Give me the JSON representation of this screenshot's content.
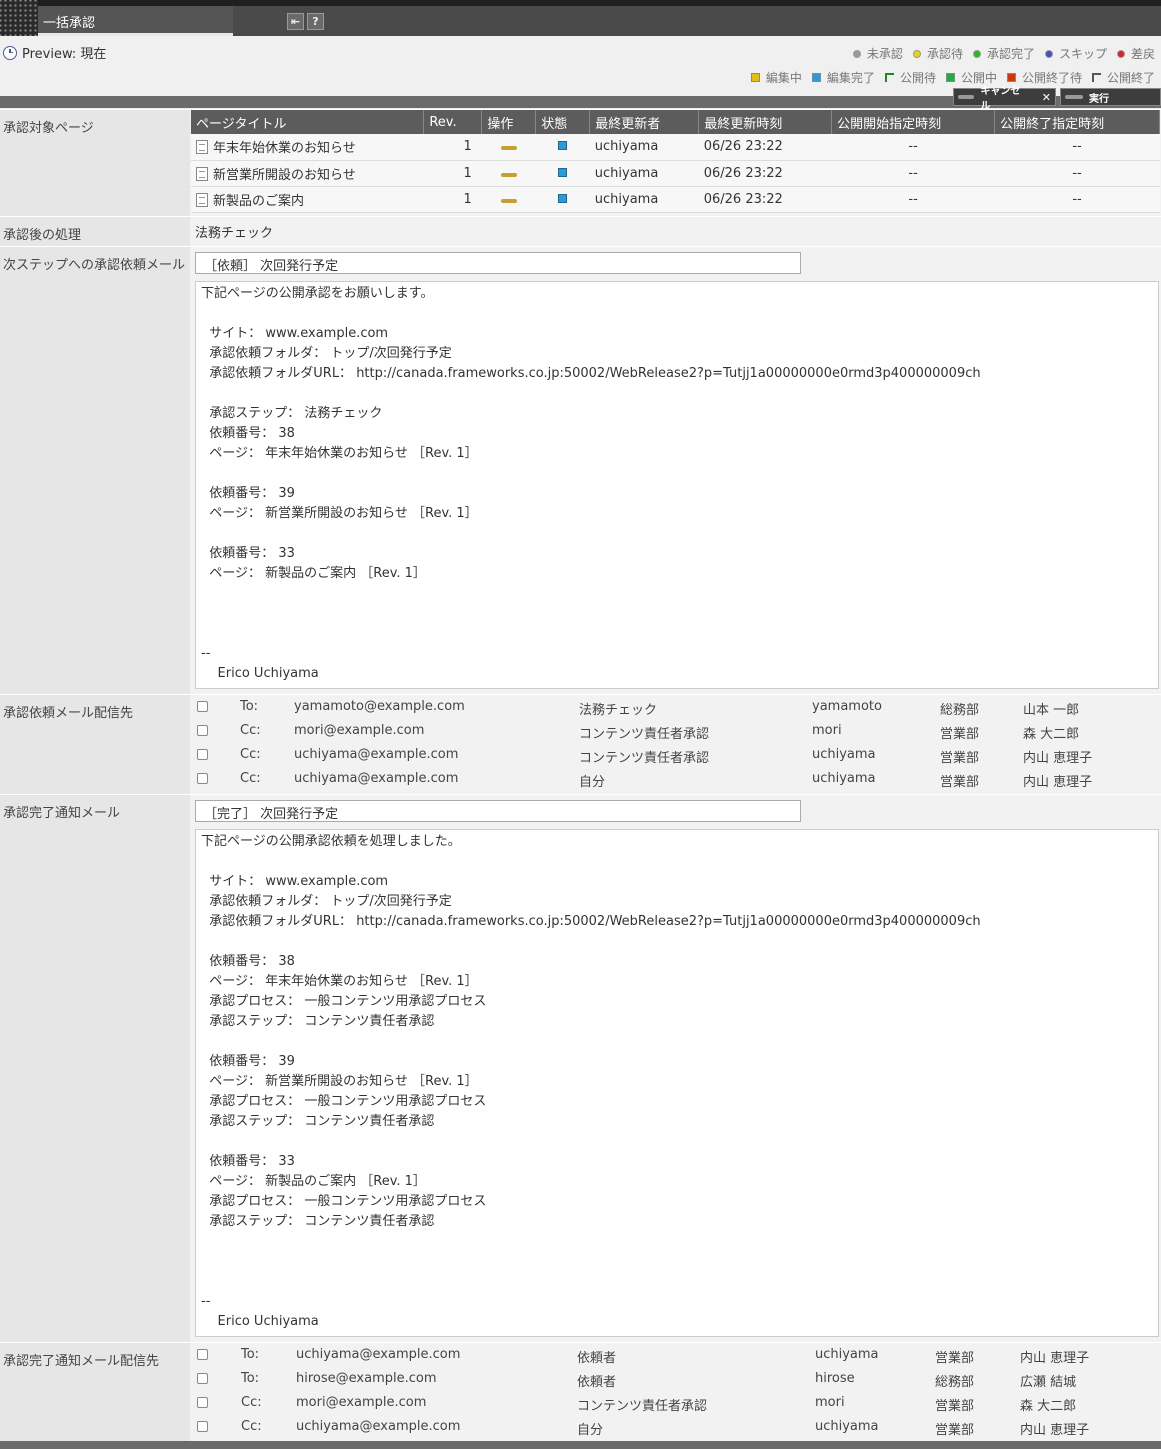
{
  "window": {
    "title": "一括承認",
    "back_label": "⇤",
    "help_label": "?"
  },
  "preview": {
    "label": "Preview: 現在"
  },
  "legend_approval": [
    {
      "label": "未承認",
      "color": "#999999"
    },
    {
      "label": "承認待",
      "color": "#e8d800"
    },
    {
      "label": "承認完了",
      "color": "#22bb22"
    },
    {
      "label": "スキップ",
      "color": "#4a4acc"
    },
    {
      "label": "差戻",
      "color": "#dd2222"
    }
  ],
  "legend_status": [
    {
      "label": "編集中",
      "color": "#e8c000",
      "shape": "square"
    },
    {
      "label": "編集完了",
      "color": "#2a9ad8",
      "shape": "square"
    },
    {
      "label": "公開待",
      "color": "#228822",
      "shape": "corner"
    },
    {
      "label": "公開中",
      "color": "#22aa44",
      "shape": "square"
    },
    {
      "label": "公開終了待",
      "color": "#dd3300",
      "shape": "square"
    },
    {
      "label": "公開終了",
      "color": "#555555",
      "shape": "corner"
    }
  ],
  "actions": {
    "cancel": "キャンセル",
    "cancel_x": "✕",
    "execute": "実行"
  },
  "rows": {
    "target_pages": "承認対象ページ",
    "after_approval": "承認後の処理",
    "next_step_mail": "次ステップへの承認依頼メール",
    "request_recipients": "承認依頼メール配信先",
    "completion_mail": "承認完了通知メール",
    "completion_recipients": "承認完了通知メール配信先"
  },
  "pages_table": {
    "headers": [
      "ページタイトル",
      "Rev.",
      "操作",
      "状態",
      "最終更新者",
      "最終更新時刻",
      "公開開始指定時刻",
      "公開終了指定時刻"
    ],
    "rows": [
      {
        "title": "年末年始休業のお知らせ",
        "rev": "1",
        "user": "uchiyama",
        "time": "06/26 23:22",
        "start": "--",
        "end": "--"
      },
      {
        "title": "新営業所開設のお知らせ",
        "rev": "1",
        "user": "uchiyama",
        "time": "06/26 23:22",
        "start": "--",
        "end": "--"
      },
      {
        "title": "新製品のご案内",
        "rev": "1",
        "user": "uchiyama",
        "time": "06/26 23:22",
        "start": "--",
        "end": "--"
      }
    ]
  },
  "after_approval_value": "法務チェック",
  "next_mail": {
    "subject": "［依頼］ 次回発行予定",
    "body": "下記ページの公開承認をお願いします。\n\n  サイト： www.example.com\n  承認依頼フォルダ： トップ/次回発行予定\n  承認依頼フォルダURL： http://canada.frameworks.co.jp:50002/WebRelease2?p=Tutjj1a00000000e0rmd3p400000009ch\n\n  承認ステップ： 法務チェック\n  依頼番号： 38\n  ページ： 年末年始休業のお知らせ ［Rev. 1］\n\n  依頼番号： 39\n  ページ： 新営業所開設のお知らせ ［Rev. 1］\n\n  依頼番号： 33\n  ページ： 新製品のご案内 ［Rev. 1］\n\n\n\n--\n    Erico Uchiyama"
  },
  "request_recipients": [
    {
      "type": "To:",
      "email": "yamamoto@example.com",
      "role": "法務チェック",
      "user": "yamamoto",
      "dept": "総務部",
      "name": "山本 一郎"
    },
    {
      "type": "Cc:",
      "email": "mori@example.com",
      "role": "コンテンツ責任者承認",
      "user": "mori",
      "dept": "営業部",
      "name": "森 大二郎"
    },
    {
      "type": "Cc:",
      "email": "uchiyama@example.com",
      "role": "コンテンツ責任者承認",
      "user": "uchiyama",
      "dept": "営業部",
      "name": "内山 恵理子"
    },
    {
      "type": "Cc:",
      "email": "uchiyama@example.com",
      "role": "自分",
      "user": "uchiyama",
      "dept": "営業部",
      "name": "内山 恵理子"
    }
  ],
  "completion_mail": {
    "subject": "［完了］ 次回発行予定",
    "body": "下記ページの公開承認依頼を処理しました。\n\n  サイト： www.example.com\n  承認依頼フォルダ： トップ/次回発行予定\n  承認依頼フォルダURL： http://canada.frameworks.co.jp:50002/WebRelease2?p=Tutjj1a00000000e0rmd3p400000009ch\n\n  依頼番号： 38\n  ページ： 年末年始休業のお知らせ ［Rev. 1］\n  承認プロセス： 一般コンテンツ用承認プロセス\n  承認ステップ： コンテンツ責任者承認\n\n  依頼番号： 39\n  ページ： 新営業所開設のお知らせ ［Rev. 1］\n  承認プロセス： 一般コンテンツ用承認プロセス\n  承認ステップ： コンテンツ責任者承認\n\n  依頼番号： 33\n  ページ： 新製品のご案内 ［Rev. 1］\n  承認プロセス： 一般コンテンツ用承認プロセス\n  承認ステップ： コンテンツ責任者承認\n\n\n\n--\n    Erico Uchiyama"
  },
  "completion_recipients": [
    {
      "type": "To:",
      "email": "uchiyama@example.com",
      "role": "依頼者",
      "user": "uchiyama",
      "dept": "営業部",
      "name": "内山 恵理子"
    },
    {
      "type": "To:",
      "email": "hirose@example.com",
      "role": "依頼者",
      "user": "hirose",
      "dept": "総務部",
      "name": "広瀬 結城"
    },
    {
      "type": "Cc:",
      "email": "mori@example.com",
      "role": "コンテンツ責任者承認",
      "user": "mori",
      "dept": "営業部",
      "name": "森 大二郎"
    },
    {
      "type": "Cc:",
      "email": "uchiyama@example.com",
      "role": "自分",
      "user": "uchiyama",
      "dept": "営業部",
      "name": "内山 恵理子"
    }
  ]
}
